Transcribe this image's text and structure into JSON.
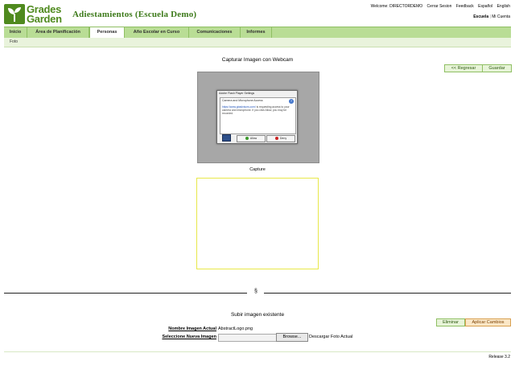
{
  "logo": {
    "line1": "Grades",
    "line2": "Garden"
  },
  "header": {
    "school_title": "Adiestamientos (Escuela Demo)",
    "welcome": "Welcome: DIRECTORDEMO",
    "links": [
      "Cerrar Sesion",
      "Feedback",
      "Español",
      "English"
    ],
    "school_label": "Escuela",
    "separator": "|",
    "account_label": "Mi Cuenta"
  },
  "nav": {
    "tabs": [
      "Inicio",
      "Área de Planificación",
      "Personas",
      "Año Escolar en Curso",
      "Comunicaciones",
      "Informes"
    ],
    "active_tab": "Personas",
    "sub_items": [
      "Foto"
    ]
  },
  "webcam_section": {
    "title": "Capturar Imagen con Webcam",
    "back_button": "<< Regresar",
    "save_button": "Guardar",
    "capture_label": "Capture",
    "flash_dialog": {
      "title": "Adobe Flash Player Settings",
      "heading": "Camera and Microphone Access",
      "url": "https://www.gbadvisors.com/",
      "body": "is requesting access to your camera and microphone. If you click Allow, you may be recorded.",
      "allow": "Allow",
      "deny": "Deny"
    }
  },
  "divider": {
    "mark": "§"
  },
  "upload_section": {
    "title": "Subir imagen existente",
    "delete_button": "Eliminar",
    "apply_button": "Aplicar Cambios",
    "current_image_label": "Nombre Imagen Actual",
    "current_image_value": "AbstractLogo.png",
    "new_image_label": "Seleccione Nueva Imagen",
    "browse_button": "Browse...",
    "discard_label": "Descargar Foto Actual"
  },
  "footer": {
    "release": "Release 3.2"
  },
  "colors": {
    "brand_green": "#4f8a1e",
    "nav_green": "#b9dd95",
    "capture_border": "#e8e84a"
  }
}
